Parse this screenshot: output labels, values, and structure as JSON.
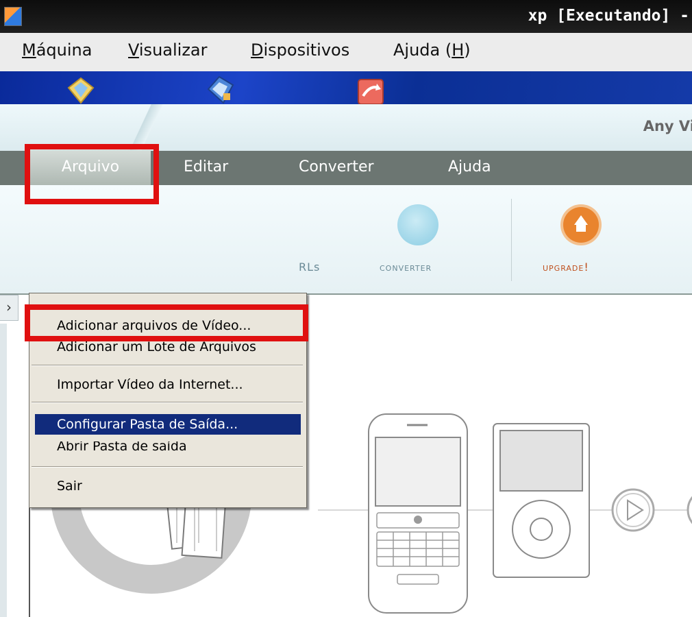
{
  "host": {
    "title": "xp [Executando] -",
    "menu": [
      {
        "pre": "",
        "mnemonic": "M",
        "post": "áquina"
      },
      {
        "pre": "",
        "mnemonic": "V",
        "post": "isualizar"
      },
      {
        "pre": "",
        "mnemonic": "D",
        "post": "ispositivos"
      },
      {
        "pre": "Ajuda (",
        "mnemonic": "H",
        "post": ")"
      }
    ]
  },
  "app": {
    "title": "Any Vi",
    "menu": {
      "file": "Arquivo",
      "edit": "Editar",
      "convert": "Converter",
      "help": "Ajuda"
    },
    "toolbar": {
      "urls": "RLs",
      "convert": "Converter",
      "upgrade": "Upgrade!"
    },
    "file_menu": [
      "Adicionar arquivos de Vídeo...",
      "Adicionar um Lote de Arquivos",
      "Importar Vídeo da Internet...",
      "Configurar Pasta de Saída...",
      "Abrir Pasta de saída",
      "Sair"
    ]
  },
  "colors": {
    "highlight": "#112b7c",
    "annotation": "#e01010",
    "app_menubar": "#6c7672",
    "upgrade": "#e9842e"
  }
}
